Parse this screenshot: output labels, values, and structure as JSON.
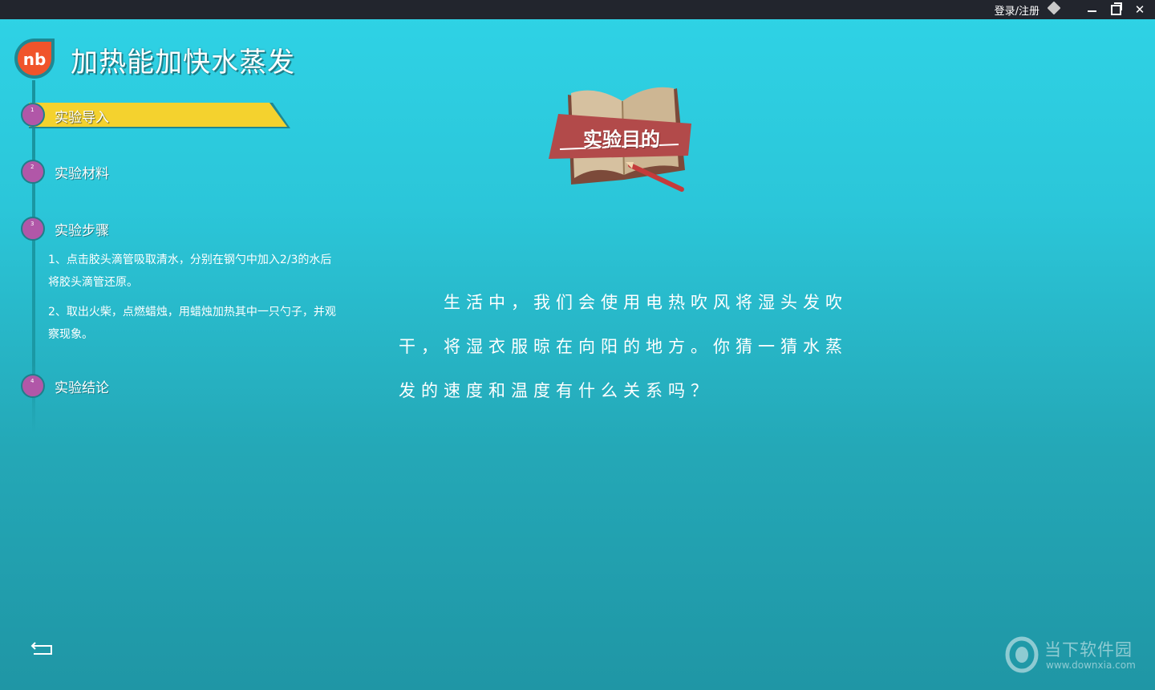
{
  "titlebar": {
    "login_label": "登录/注册"
  },
  "logo": {
    "text": "nb"
  },
  "page": {
    "title": "加热能加快水蒸发"
  },
  "nav": {
    "steps": [
      {
        "number": "1",
        "label": "实验导入"
      },
      {
        "number": "2",
        "label": "实验材料"
      },
      {
        "number": "3",
        "label": "实验步骤"
      },
      {
        "number": "4",
        "label": "实验结论"
      }
    ],
    "active_index": 0,
    "details": [
      "1、点击胶头滴管吸取清水，分别在钢勺中加入2/3的水后将胶头滴管还原。",
      "2、取出火柴，点燃蜡烛，用蜡烛加热其中一只勺子，并观察现象。"
    ]
  },
  "content": {
    "purpose_label": "实验目的",
    "intro_text": "生活中，我们会使用电热吹风将湿头发吹干，将湿衣服晾在向阳的地方。你猜一猜水蒸发的速度和温度有什么关系吗？"
  },
  "watermark": {
    "title": "当下软件园",
    "url": "www.downxia.com"
  },
  "colors": {
    "accent_yellow": "#f4d22e",
    "step_dot": "#b157a8",
    "logo_orange": "#f0542b",
    "banner_red": "#b24a4a"
  },
  "icons": {
    "back": "back-arrow-icon",
    "minimize": "minimize-icon",
    "maximize": "maximize-icon",
    "close": "close-icon",
    "skin": "diamond-icon"
  }
}
